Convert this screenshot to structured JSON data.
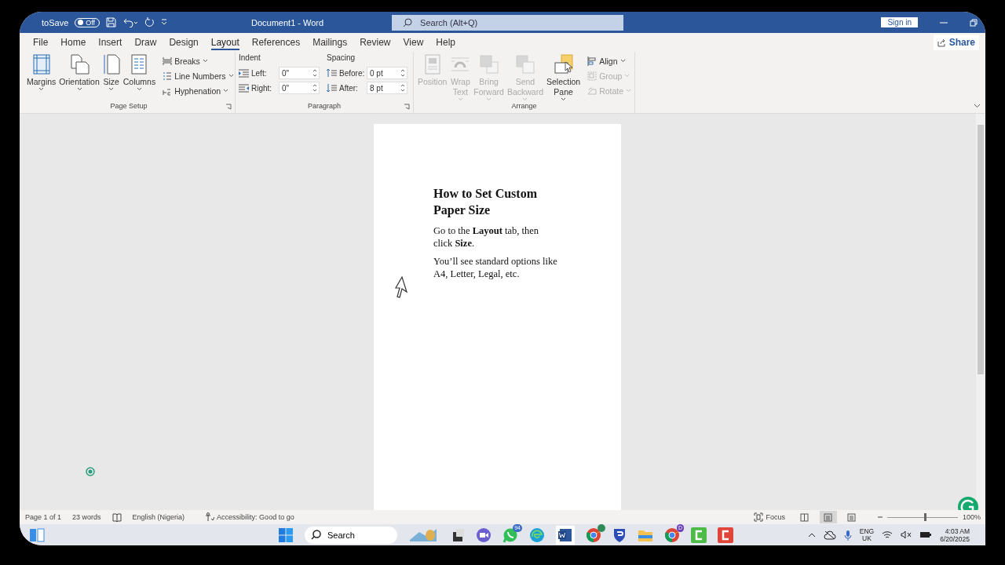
{
  "title_bar": {
    "autosave_label": "toSave",
    "autosave_toggle": {
      "label": "Off",
      "on": false
    },
    "title": "Document1 - Word",
    "search": {
      "placeholder": "Search (Alt+Q)"
    },
    "sign_in": "Sign in"
  },
  "menu_tabs": [
    {
      "label": "File",
      "selected": false
    },
    {
      "label": "Home",
      "selected": false
    },
    {
      "label": "Insert",
      "selected": false
    },
    {
      "label": "Draw",
      "selected": false
    },
    {
      "label": "Design",
      "selected": false
    },
    {
      "label": "Layout",
      "selected": true
    },
    {
      "label": "References",
      "selected": false
    },
    {
      "label": "Mailings",
      "selected": false
    },
    {
      "label": "Review",
      "selected": false
    },
    {
      "label": "View",
      "selected": false
    },
    {
      "label": "Help",
      "selected": false
    }
  ],
  "share": "Share",
  "page_setup": {
    "label": "Page Setup",
    "large": [
      {
        "lines": [
          "Margins"
        ],
        "disabled": false
      },
      {
        "lines": [
          "Orientation"
        ],
        "disabled": false
      },
      {
        "lines": [
          "Size"
        ],
        "disabled": false
      },
      {
        "lines": [
          "Columns"
        ],
        "disabled": false
      }
    ],
    "small": [
      {
        "label": "Breaks",
        "disabled": false
      },
      {
        "label": "Line Numbers",
        "disabled": false
      },
      {
        "label": "Hyphenation",
        "disabled": false
      }
    ]
  },
  "paragraph": {
    "label": "Paragraph",
    "indent": {
      "heading": "Indent",
      "fields": [
        {
          "label": "Left:",
          "value": "0\""
        },
        {
          "label": "Right:",
          "value": "0\""
        }
      ]
    },
    "spacing": {
      "heading": "Spacing",
      "fields": [
        {
          "label": "Before:",
          "value": "0 pt"
        },
        {
          "label": "After:",
          "value": "8 pt"
        }
      ]
    }
  },
  "arrange": {
    "label": "Arrange",
    "large": [
      {
        "lines": [
          "Position"
        ],
        "disabled": true
      },
      {
        "lines": [
          "Wrap",
          "Text"
        ],
        "disabled": true
      },
      {
        "lines": [
          "Bring",
          "Forward"
        ],
        "disabled": true
      },
      {
        "lines": [
          "Send",
          "Backward"
        ],
        "disabled": true
      },
      {
        "lines": [
          "Selection",
          "Pane"
        ],
        "disabled": false
      }
    ],
    "small": [
      {
        "label": "Align",
        "disabled": false
      },
      {
        "label": "Group",
        "disabled": true
      },
      {
        "label": "Rotate",
        "disabled": true
      }
    ]
  },
  "document": {
    "heading": "How to Set Custom Paper Size",
    "paragraphs": [
      "Go to the **Layout** tab, then click **Size**.",
      "You’ll see standard options like A4, Letter, Legal, etc."
    ]
  },
  "status_bar": {
    "page": "Page 1 of 1",
    "words": "23 words",
    "language": "English (Nigeria)",
    "accessibility": "Accessibility: Good to go",
    "focus": "Focus",
    "views": [
      {
        "selected": false
      },
      {
        "selected": true
      },
      {
        "selected": false
      }
    ],
    "zoom": {
      "level": 0.52,
      "reading": "100%"
    }
  },
  "taskbar": {
    "search": "Search",
    "badge": "94",
    "profile_badge": "D",
    "language": "ENG",
    "region": "UK",
    "time": "4:03 AM",
    "date": "6/20/2025"
  }
}
